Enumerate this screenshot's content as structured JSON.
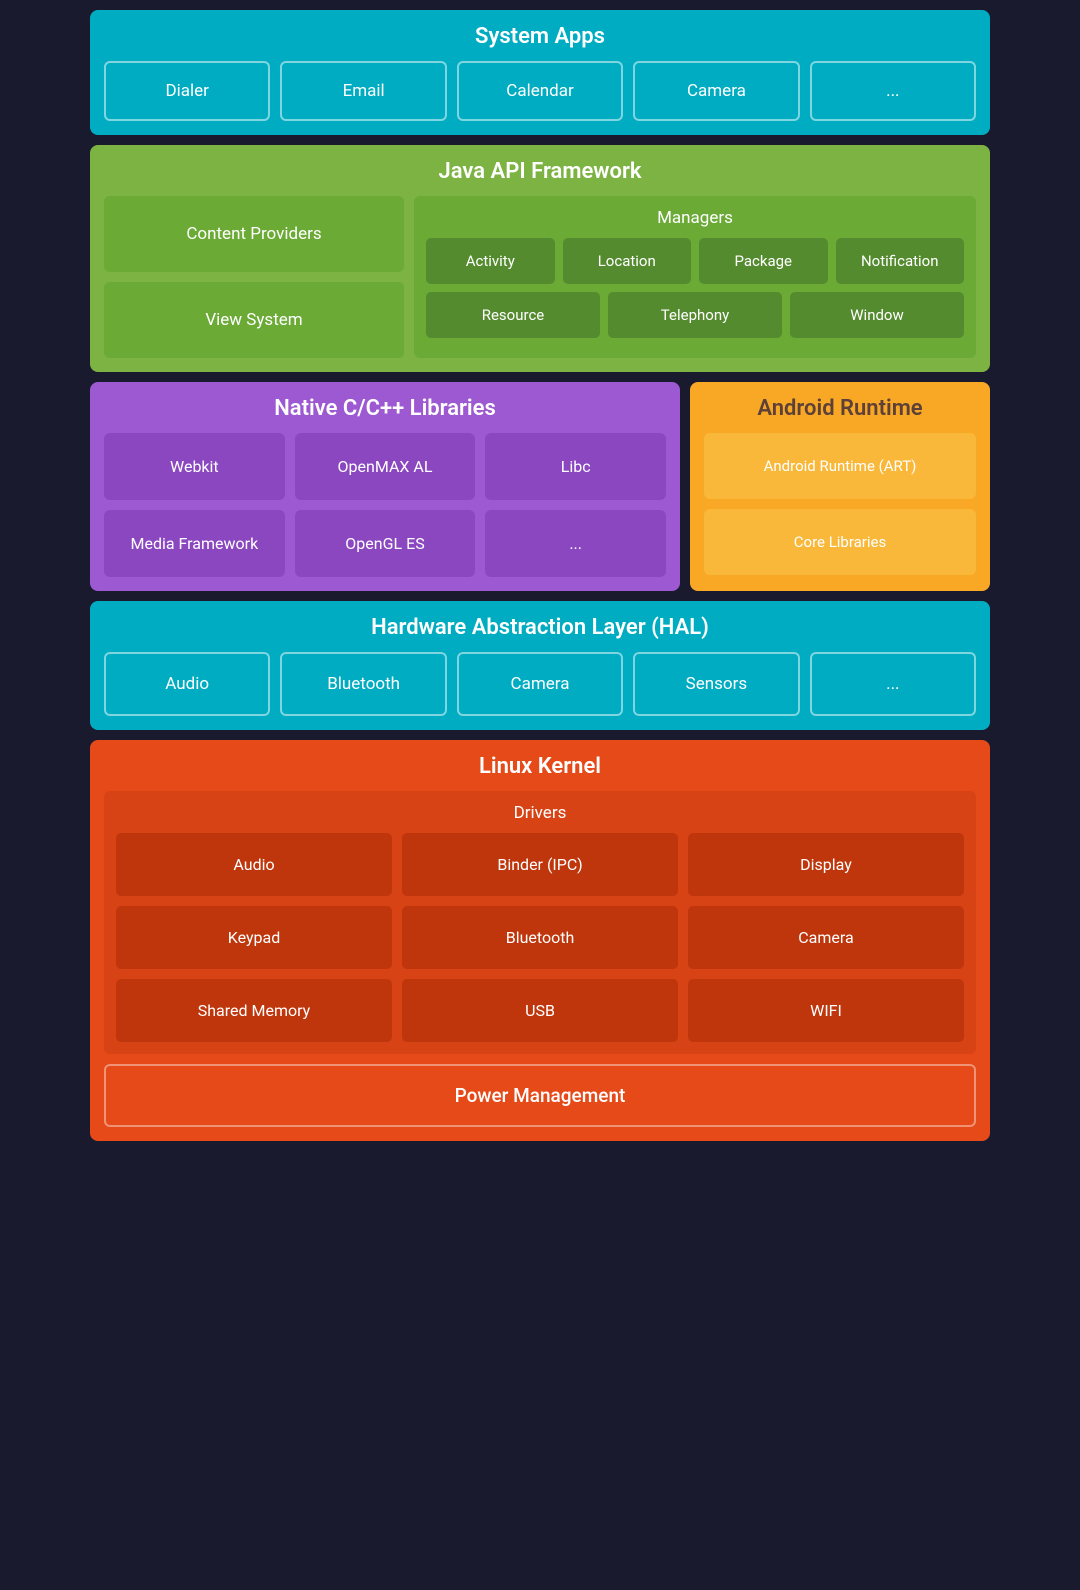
{
  "system_apps": {
    "title": "System Apps",
    "apps": [
      "Dialer",
      "Email",
      "Calendar",
      "Camera",
      "..."
    ]
  },
  "java_api": {
    "title": "Java API Framework",
    "left_items": [
      "Content Providers",
      "View System"
    ],
    "managers": {
      "title": "Managers",
      "row1": [
        "Activity",
        "Location",
        "Package",
        "Notification"
      ],
      "row2": [
        "Resource",
        "Telephony",
        "Window"
      ]
    }
  },
  "native_libs": {
    "title": "Native C/C++ Libraries",
    "items": [
      "Webkit",
      "OpenMAX AL",
      "Libc",
      "Media Framework",
      "OpenGL ES",
      "..."
    ]
  },
  "android_runtime": {
    "title": "Android Runtime",
    "items": [
      "Android Runtime (ART)",
      "Core Libraries"
    ]
  },
  "hal": {
    "title": "Hardware Abstraction Layer (HAL)",
    "items": [
      "Audio",
      "Bluetooth",
      "Camera",
      "Sensors",
      "..."
    ]
  },
  "linux_kernel": {
    "title": "Linux Kernel",
    "drivers_title": "Drivers",
    "drivers": [
      "Audio",
      "Binder (IPC)",
      "Display",
      "Keypad",
      "Bluetooth",
      "Camera",
      "Shared Memory",
      "USB",
      "WIFI"
    ],
    "power_management": "Power Management"
  }
}
